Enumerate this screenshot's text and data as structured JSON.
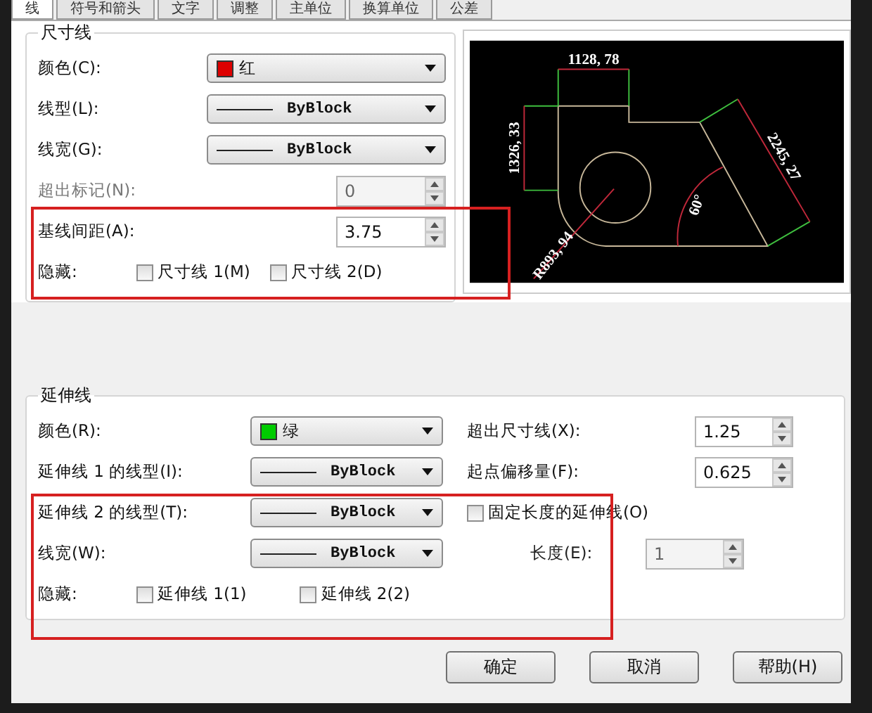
{
  "tabs": [
    {
      "label": "线",
      "selected": true
    },
    {
      "label": "符号和箭头",
      "selected": false
    },
    {
      "label": "文字",
      "selected": false
    },
    {
      "label": "调整",
      "selected": false
    },
    {
      "label": "主单位",
      "selected": false
    },
    {
      "label": "换算单位",
      "selected": false
    },
    {
      "label": "公差",
      "selected": false
    }
  ],
  "dimension_lines": {
    "title": "尺寸线",
    "fields": [
      {
        "kind": "color",
        "label": "颜色(C):",
        "value": "红",
        "color": "#dd0000"
      },
      {
        "kind": "linetype",
        "label": "线型(L):",
        "value": "ByBlock"
      },
      {
        "kind": "linetype",
        "label": "线宽(G):",
        "value": "ByBlock"
      },
      {
        "kind": "spinner",
        "label": "超出标记(N):",
        "value": "0",
        "disabled": true
      },
      {
        "kind": "spinner",
        "label": "基线间距(A):",
        "value": "3.75",
        "disabled": false
      }
    ],
    "hide": {
      "label": "隐藏:",
      "checkboxes": [
        {
          "label": "尺寸线 1(M)",
          "checked": false
        },
        {
          "label": "尺寸线 2(D)",
          "checked": false
        }
      ]
    }
  },
  "preview": {
    "labels": [
      "1128, 78",
      "1326, 33",
      "2245, 27",
      "60°",
      "R893, 94"
    ]
  },
  "extension_lines": {
    "title": "延伸线",
    "fields": [
      {
        "kind": "color",
        "label": "颜色(R):",
        "value": "绿",
        "color": "#00cc00"
      },
      {
        "kind": "linetype",
        "label": "延伸线 1 的线型(I):",
        "value": "ByBlock"
      },
      {
        "kind": "linetype",
        "label": "延伸线 2 的线型(T):",
        "value": "ByBlock"
      },
      {
        "kind": "linetype",
        "label": "线宽(W):",
        "value": "ByBlock"
      }
    ],
    "hide": {
      "label": "隐藏:",
      "checkboxes": [
        {
          "label": "延伸线 1(1)",
          "checked": false
        },
        {
          "label": "延伸线 2(2)",
          "checked": false
        }
      ]
    },
    "right_fields": [
      {
        "kind": "spinner",
        "label": "超出尺寸线(X):",
        "value": "1.25",
        "disabled": false
      },
      {
        "kind": "spinner",
        "label": "起点偏移量(F):",
        "value": "0.625",
        "disabled": false
      },
      {
        "kind": "checkbox",
        "label": "固定长度的延伸线(O)",
        "checked": false
      },
      {
        "kind": "spinner",
        "label": "长度(E):",
        "value": "1",
        "disabled": true
      }
    ]
  },
  "buttons": [
    "确定",
    "取消",
    "帮助(H)"
  ]
}
